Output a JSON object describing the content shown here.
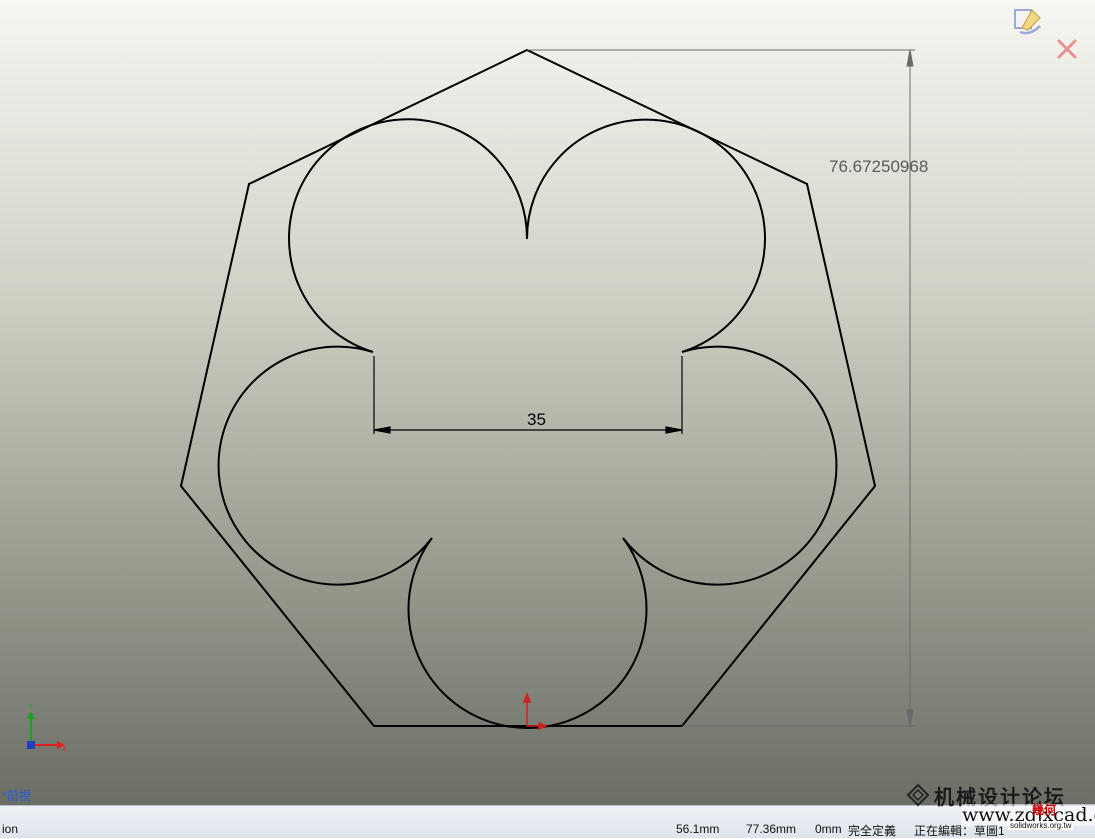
{
  "viewport": {
    "dimension_vertical": "76.67250968",
    "dimension_horizontal": "35",
    "view_label": "*前視"
  },
  "statusbar": {
    "left_text": "ion",
    "x": "56.1mm",
    "y": "77.36mm",
    "z": "0mm",
    "state": "完全定義",
    "editing": "正在編輯：草圖1"
  },
  "watermark": {
    "title": "机械设计论坛",
    "domain": "www.zgjxcad.com",
    "badge": "solidworks.org.tw",
    "brand": "幾何"
  },
  "colors": {
    "sketch_line": "#000000",
    "dimension_line": "#5a5a5a",
    "axis_x": "#e02020",
    "axis_y": "#20a020",
    "view_label": "#2a5bd6"
  },
  "icons": {
    "confirm": "confirm-sketch-icon",
    "exit": "exit-sketch-icon",
    "triad": "view-triad-icon",
    "origin": "sketch-origin-icon"
  }
}
